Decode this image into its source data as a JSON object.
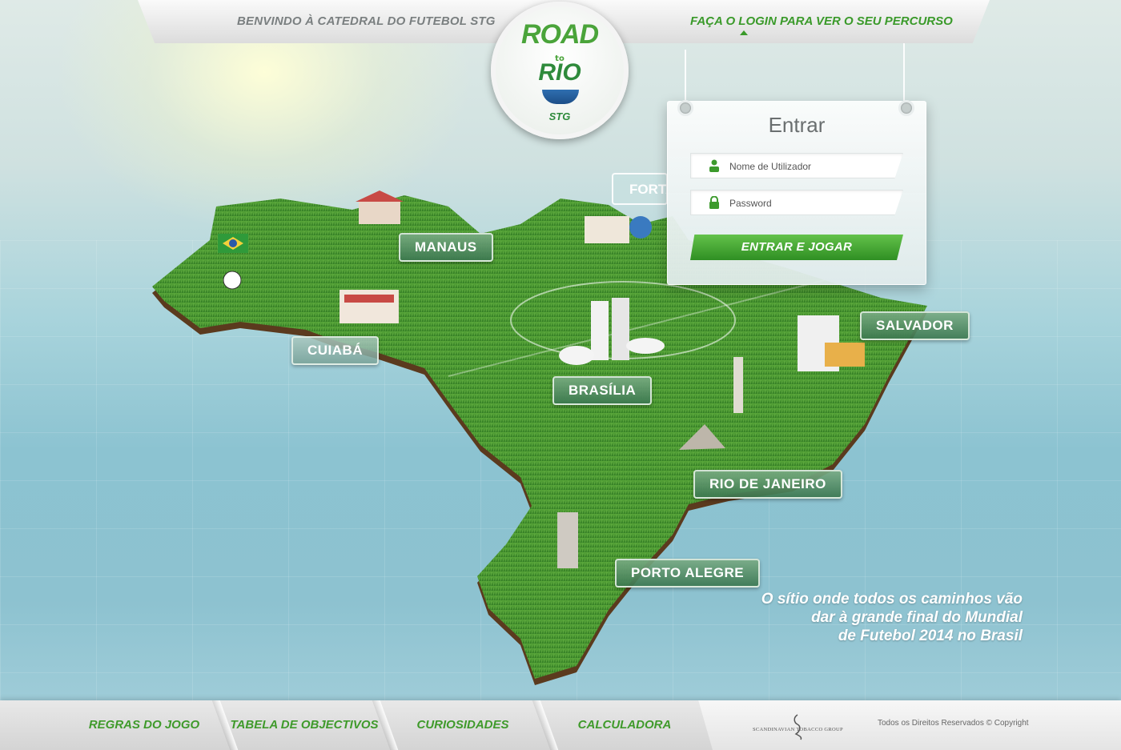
{
  "header": {
    "welcome_text": "BENVINDO À CATEDRAL DO FUTEBOL STG",
    "login_prompt": "FAÇA O LOGIN PARA VER O SEU PERCURSO"
  },
  "logo": {
    "line1": "ROAD",
    "line2": "to",
    "line3": "RIO",
    "line4": "STG"
  },
  "login": {
    "title": "Entrar",
    "username_placeholder": "Nome de Utilizador",
    "password_placeholder": "Password",
    "submit_label": "ENTRAR E JOGAR",
    "username_icon": "user-icon",
    "password_icon": "lock-icon"
  },
  "cities": {
    "manaus": "MANAUS",
    "fortaleza_partial": "FORTA",
    "cuiaba": "CUIABÁ",
    "brasilia": "BRASÍLIA",
    "salvador": "SALVADOR",
    "rio": "RIO DE JANEIRO",
    "porto_alegre": "PORTO ALEGRE"
  },
  "tagline": {
    "line1": "O sítio onde todos os caminhos vão",
    "line2": "dar à grande final do Mundial",
    "line3": "de Futebol 2014 no Brasil"
  },
  "footer": {
    "nav": [
      "REGRAS DO JOGO",
      "TABELA DE OBJECTIVOS",
      "CURIOSIDADES",
      "CALCULADORA"
    ],
    "company": "SCANDINAVIAN TOBACCO GROUP",
    "copyright": "Todos os Direitos Reservados © Copyright"
  },
  "colors": {
    "accent_green": "#3f9a2b",
    "button_green": "#4aa83a",
    "ocean": "#8cc3d1"
  }
}
